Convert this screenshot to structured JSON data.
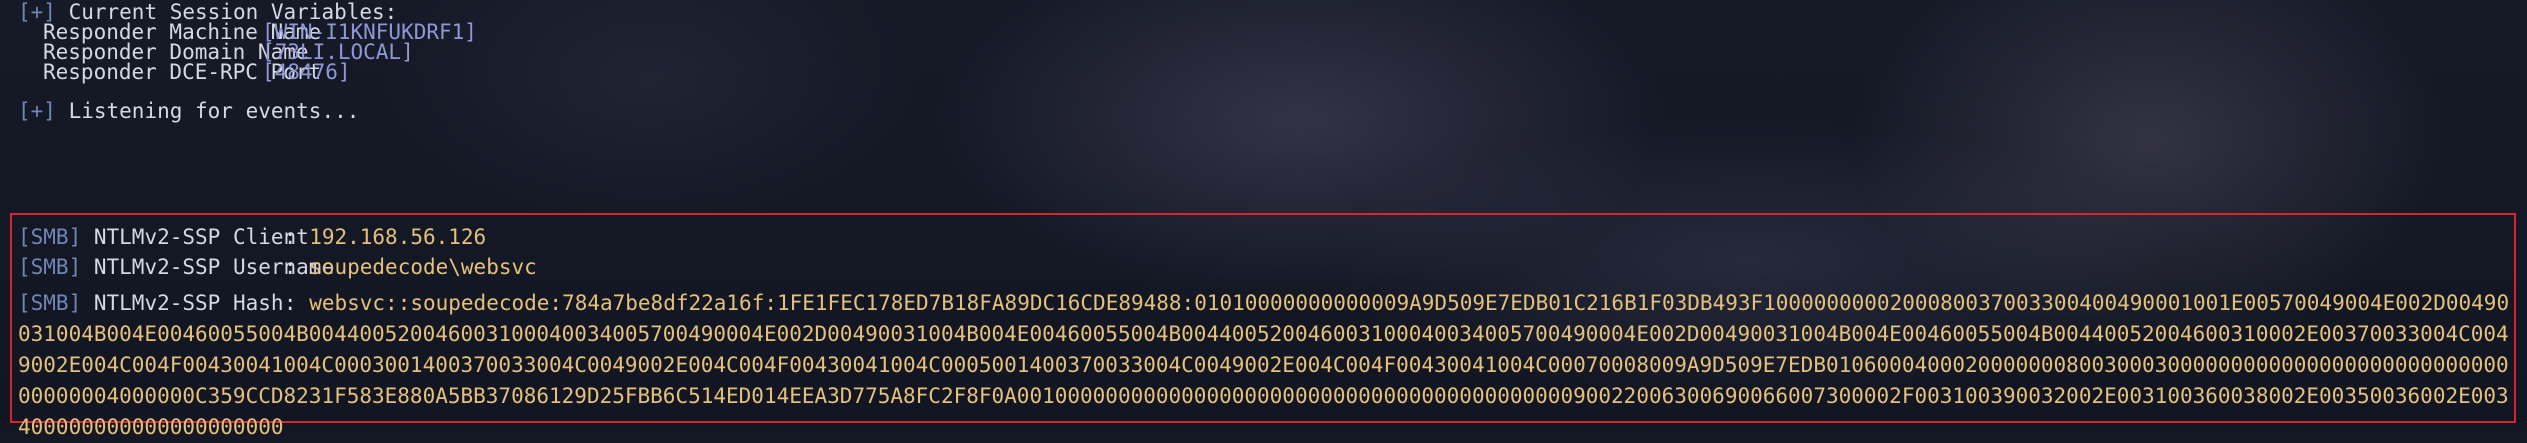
{
  "session": {
    "header_tag": "[+]",
    "header": "Current Session Variables:",
    "vars": [
      {
        "label": "Responder Machine Name",
        "value": "[WIN-I1KNFUKDRF1]"
      },
      {
        "label": "Responder Domain Name",
        "value": "[73LI.LOCAL]"
      },
      {
        "label": "Responder DCE-RPC Port",
        "value": "[48476]"
      }
    ]
  },
  "listening": {
    "tag": "[+]",
    "text": "Listening for events..."
  },
  "capture": {
    "lines": [
      {
        "tag": "[SMB]",
        "label": "NTLMv2-SSP Client",
        "sep": ":",
        "value": "192.168.56.126"
      },
      {
        "tag": "[SMB]",
        "label": "NTLMv2-SSP Username",
        "sep": ":",
        "value": "soupedecode\\websvc"
      },
      {
        "tag": "[SMB]",
        "label": "NTLMv2-SSP Hash",
        "sep": ":",
        "value": "websvc::soupedecode:784a7be8df22a16f:1FE1FEC178ED7B18FA89DC16CDE89488:01010000000000009A9D509E7EDB01C216B1F03DB493F1000000000200080037003300400490001001E00570049004E002D00490031004B004E00460055004B004400520046003100040034005700490004E002D00490031004B004E00460055004B004400520046003100040034005700490004E002D00490031004B004E00460055004B00440052004600310002E00370033004C0049002E004C004F00430041004C0003001400370033004C0049002E004C004F00430041004C0005001400370033004C0049002E004C004F00430041004C00070008009A9D509E7EDB01060004000200000008003000300000000000000000000000000000000004000000C359CCD8231F583E880A5BB37086129D25FBB6C514ED014EEA3D775A8FC2F8F0A0010000000000000000000000000000000000000000090022006300690066007300002F003100390032002E003100360038002E00350036002E003400000000000000000000"
      }
    ]
  }
}
